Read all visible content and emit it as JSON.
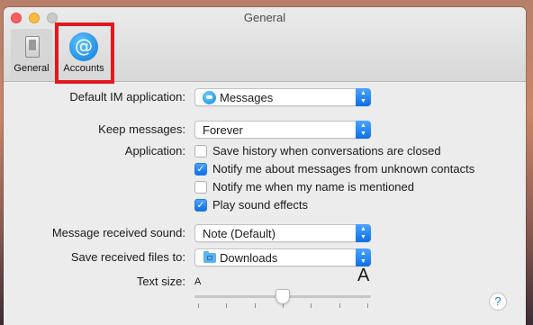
{
  "window": {
    "title": "General"
  },
  "toolbar": {
    "general_label": "General",
    "accounts_label": "Accounts",
    "accounts_icon": "at-sign-icon",
    "general_icon": "phone-switch-icon",
    "highlight_color": "#e0191e"
  },
  "settings": {
    "default_im_label": "Default IM application:",
    "default_im_value": "Messages",
    "keep_messages_label": "Keep messages:",
    "keep_messages_value": "Forever",
    "application_label": "Application:",
    "options": [
      {
        "label": "Save history when conversations are closed",
        "checked": false
      },
      {
        "label": "Notify me about messages from unknown contacts",
        "checked": true
      },
      {
        "label": "Notify me when my name is mentioned",
        "checked": false
      },
      {
        "label": "Play sound effects",
        "checked": true
      }
    ],
    "sound_label": "Message received sound:",
    "sound_value": "Note (Default)",
    "save_files_label": "Save received files to:",
    "save_files_value": "Downloads",
    "text_size_label": "Text size:",
    "text_size_small": "A",
    "text_size_large": "A",
    "text_size_level": 0.5
  },
  "help": {
    "label": "?"
  },
  "colors": {
    "accent": "#0d6fe6"
  }
}
